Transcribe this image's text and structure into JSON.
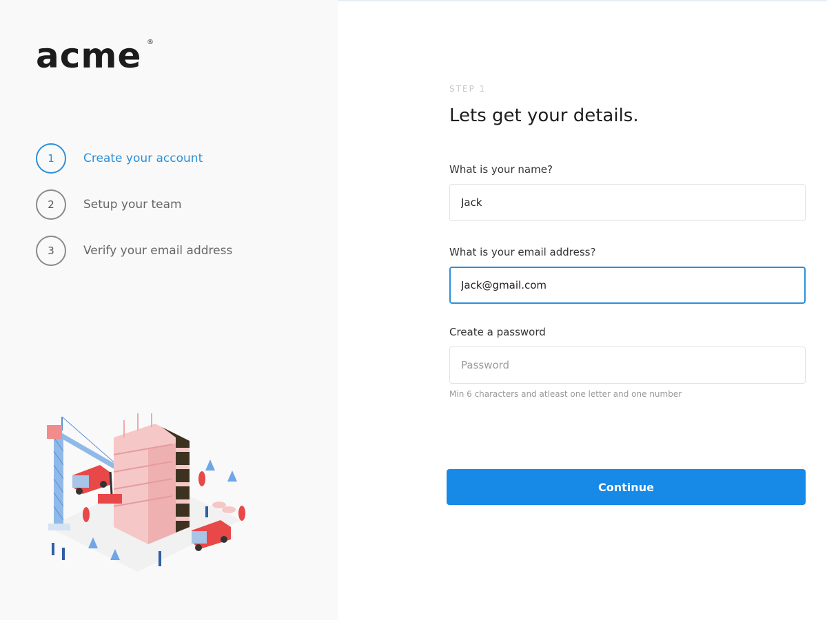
{
  "brand": {
    "logo": "acme",
    "registered_mark": "®"
  },
  "steps": [
    {
      "number": "1",
      "label": "Create your account",
      "active": true
    },
    {
      "number": "2",
      "label": "Setup your team",
      "active": false
    },
    {
      "number": "3",
      "label": "Verify your email address",
      "active": false
    }
  ],
  "form": {
    "step_tag": "STEP 1",
    "heading": "Lets get your details.",
    "name": {
      "label": "What is your name?",
      "value": "Jack"
    },
    "email": {
      "label": "What is your email address?",
      "value": "Jack@gmail.com"
    },
    "password": {
      "label": "Create a password",
      "value": "",
      "placeholder": "Password",
      "hint": "Min 6 characters and atleast one letter and one number"
    },
    "continue_label": "Continue"
  },
  "colors": {
    "accent": "#1789e6",
    "step_active": "#2b8fd9",
    "panel_bg": "#f9f9f9"
  },
  "illustration": {
    "icon": "construction-site-illustration"
  }
}
